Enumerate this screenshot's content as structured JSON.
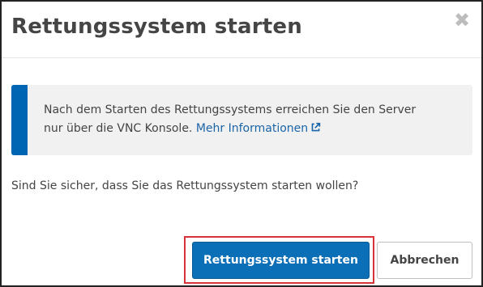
{
  "dialog": {
    "title": "Rettungssystem starten",
    "close_icon": "close-icon",
    "close_glyph": "✖"
  },
  "info": {
    "text_line1": "Nach dem Starten des Rettungssystems erreichen Sie den Server",
    "text_line2": "nur über die VNC Konsole.",
    "link_label": "Mehr Informationen",
    "link_icon": "external-link-icon",
    "accent_color": "#0066b3",
    "background_color": "#f1f1f1",
    "link_color": "#1a64a8"
  },
  "question": "Sind Sie sicher, dass Sie das Rettungssystem starten wollen?",
  "buttons": {
    "confirm_label": "Rettungssystem starten",
    "cancel_label": "Abbrechen",
    "primary_color": "#0a6fb7",
    "highlight_color": "#d9333a"
  }
}
